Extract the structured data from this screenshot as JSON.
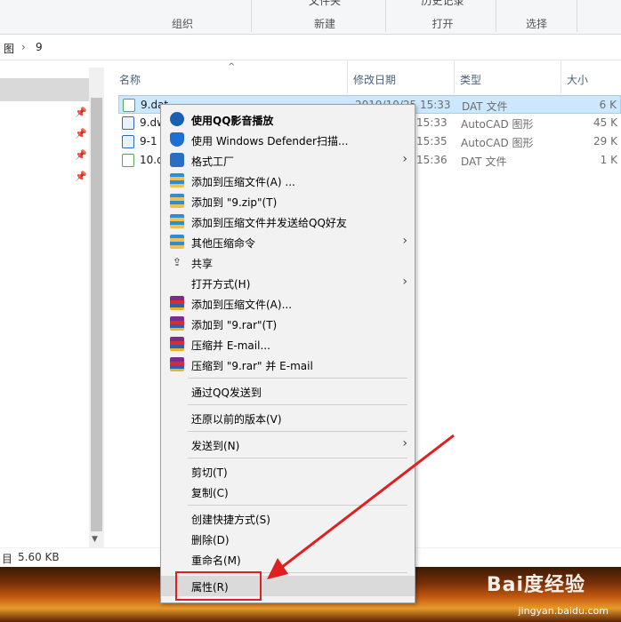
{
  "ribbon": {
    "groups": [
      {
        "top": "",
        "label": "组织"
      },
      {
        "top": "文件夹",
        "label": "新建"
      },
      {
        "top": "历史记录",
        "label": "打开"
      },
      {
        "top": "",
        "label": "选择"
      }
    ]
  },
  "address": {
    "prefix": "图",
    "sep": "›",
    "folder": "9"
  },
  "columns": {
    "name": "名称",
    "date": "修改日期",
    "type": "类型",
    "size": "大小"
  },
  "files": [
    {
      "name": "9.dat",
      "date": "2019/10/25 15:33",
      "type": "DAT 文件",
      "size": "6 K"
    },
    {
      "name": "9.dw",
      "date": "15:33",
      "type": "AutoCAD 图形",
      "size": "45 K"
    },
    {
      "name": "9-1",
      "date": "15:35",
      "type": "AutoCAD 图形",
      "size": "29 K"
    },
    {
      "name": "10.d",
      "date": "15:36",
      "type": "DAT 文件",
      "size": "1 K"
    }
  ],
  "status": {
    "items": "目",
    "size": "5.60 KB"
  },
  "menu": {
    "items": [
      {
        "label": "使用QQ影音播放",
        "icon": "qq-player-icon"
      },
      {
        "label": "使用 Windows Defender扫描...",
        "icon": "shield-icon"
      },
      {
        "label": "格式工厂",
        "icon": "format-factory-icon"
      },
      {
        "label": "添加到压缩文件(A) ...",
        "icon": "zip-icon"
      },
      {
        "label": "添加到 \"9.zip\"(T)",
        "icon": "zip-icon"
      },
      {
        "label": "添加到压缩文件并发送给QQ好友",
        "icon": "zip-icon"
      },
      {
        "label": "其他压缩命令",
        "icon": "zip-icon"
      },
      {
        "label": "共享",
        "icon": "share-icon"
      },
      {
        "label": "打开方式(H)",
        "icon": ""
      },
      {
        "label": "添加到压缩文件(A)...",
        "icon": "rar-icon"
      },
      {
        "label": "添加到 \"9.rar\"(T)",
        "icon": "rar-icon"
      },
      {
        "label": "压缩并 E-mail...",
        "icon": "rar-icon"
      },
      {
        "label": "压缩到 \"9.rar\" 并 E-mail",
        "icon": "rar-icon"
      },
      {
        "label": "通过QQ发送到",
        "icon": ""
      },
      {
        "label": "还原以前的版本(V)",
        "icon": ""
      },
      {
        "label": "发送到(N)",
        "icon": ""
      },
      {
        "label": "剪切(T)",
        "icon": ""
      },
      {
        "label": "复制(C)",
        "icon": ""
      },
      {
        "label": "创建快捷方式(S)",
        "icon": ""
      },
      {
        "label": "删除(D)",
        "icon": ""
      },
      {
        "label": "重命名(M)",
        "icon": ""
      },
      {
        "label": "属性(R)",
        "icon": ""
      }
    ]
  },
  "watermark": {
    "brand": "Bai度经验",
    "site": "jingyan.baidu.com"
  },
  "colors": {
    "selection": "#cce8ff",
    "annotation": "#e02020",
    "menu_bg": "#f2f2f2"
  }
}
